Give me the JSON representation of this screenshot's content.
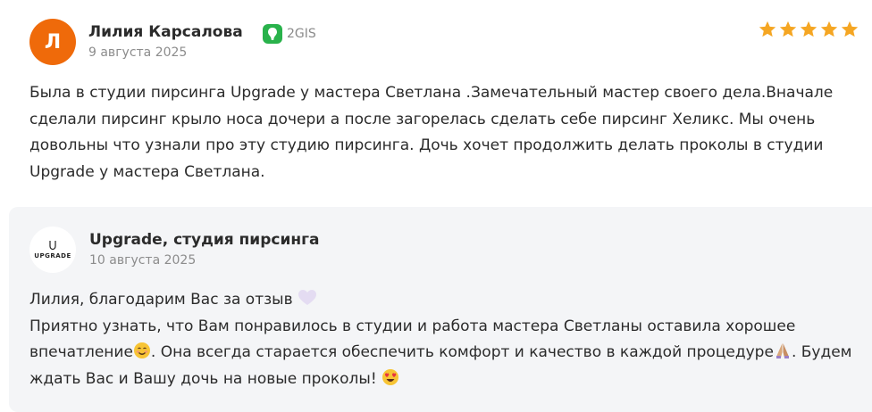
{
  "review": {
    "avatar_letter": "Л",
    "author": "Лилия Карсалова",
    "source_label": "2GIS",
    "source_icon": "2gis-icon",
    "date": "9 августа 2025",
    "rating": 5,
    "text": "Была в студии пирсинга Upgrade у мастера Светлана .Замечательный мастер своего дела.Вначале сделали пирсинг крыло носа дочери а после загорелась сделать себе пирсинг Хеликс. Мы очень довольны что узнали про эту студию пирсинга. Дочь хочет продолжить делать проколы в студии Upgrade у мастера Светлана."
  },
  "reply": {
    "logo_text": "UPGRADE",
    "org_name": "Upgrade, студия пирсинга",
    "date": "10 августа 2025",
    "line1": "Лилия, благодарим Вас за отзыв",
    "line2_a": "Приятно узнать, что Вам понравилось в студии и работа мастера Светланы оставила хорошее впечатление",
    "line2_b": ". Она всегда старается обеспечить комфорт и качество в каждой процедуре",
    "line2_c": ". Будем ждать Вас и Вашу дочь на новые проколы! "
  },
  "colors": {
    "avatar_bg": "#ef6a0a",
    "star": "#f5a623",
    "source_green": "#29b24b",
    "reply_bg": "#f4f5f7"
  }
}
